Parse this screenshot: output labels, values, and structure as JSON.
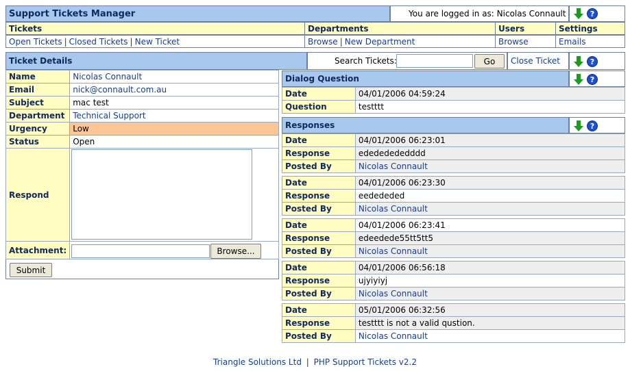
{
  "app": {
    "title": "Support Tickets Manager",
    "logged_in_text": "You are logged in as: Nicolas Connault"
  },
  "nav": {
    "tickets": {
      "title": "Tickets",
      "links": [
        "Open Tickets",
        "Closed Tickets",
        "New Ticket"
      ]
    },
    "departments": {
      "title": "Departments",
      "links": [
        "Browse",
        "New Department"
      ]
    },
    "users": {
      "title": "Users",
      "links": [
        "Browse"
      ]
    },
    "settings": {
      "title": "Settings",
      "links": [
        "Emails"
      ]
    }
  },
  "toolbar": {
    "section_title": "Ticket Details",
    "search_label": "Search Tickets:",
    "search_value": "",
    "go_label": "Go",
    "close_ticket_label": "Close Ticket"
  },
  "ticket": {
    "name_label": "Name",
    "name": "Nicolas Connault",
    "email_label": "Email",
    "email": "nick@connault.com.au",
    "subject_label": "Subject",
    "subject": "mac test",
    "department_label": "Department",
    "department": "Technical Support",
    "urgency_label": "Urgency",
    "urgency": "Low",
    "status_label": "Status",
    "status": "Open",
    "respond_label": "Respond",
    "attachment_label": "Attachment:",
    "browse_label": "Browse...",
    "submit_label": "Submit"
  },
  "dialog": {
    "title": "Dialog Question",
    "date_label": "Date",
    "date": "04/01/2006 04:59:24",
    "question_label": "Question",
    "question": "testttt"
  },
  "responses": {
    "title": "Responses",
    "date_label": "Date",
    "response_label": "Response",
    "posted_by_label": "Posted By",
    "items": [
      {
        "date": "04/01/2006 06:23:01",
        "response": "edededededddd",
        "posted_by": "Nicolas Connault"
      },
      {
        "date": "04/01/2006 06:23:30",
        "response": "eedededed",
        "posted_by": "Nicolas Connault"
      },
      {
        "date": "04/01/2006 06:23:41",
        "response": "edeedede55tt5tt5",
        "posted_by": "Nicolas Connault"
      },
      {
        "date": "04/01/2006 06:56:18",
        "response": "ujyiyiyj",
        "posted_by": "Nicolas Connault"
      },
      {
        "date": "05/01/2006 06:32:56",
        "response": "testttt is not a valid qustion.",
        "posted_by": "Nicolas Connault"
      }
    ]
  },
  "footer": {
    "company": "Triangle Solutions Ltd",
    "separator": "|",
    "product": "PHP Support Tickets v2.2"
  },
  "colors": {
    "header_blue": "#a9c8ee",
    "label_yellow": "#fffcc2",
    "urgency_orange": "#fcc596",
    "link_blue": "#1a3d8f"
  },
  "icons": [
    "arrow-down-icon",
    "help-icon"
  ]
}
